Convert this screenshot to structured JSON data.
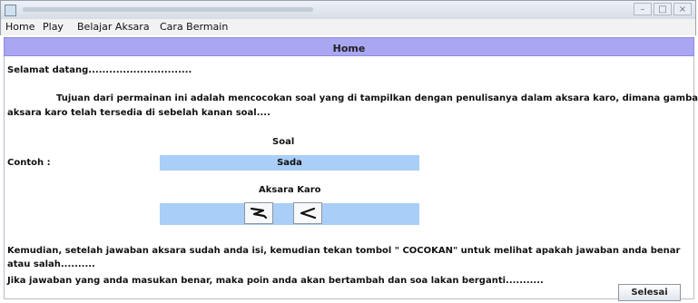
{
  "menu": [
    "Home",
    "Play",
    "Belajar Aksara",
    "Cara Bermain"
  ],
  "header": {
    "title": "Home"
  },
  "content": {
    "greeting": "Selamat datang..............................",
    "intro_line1": "Tujuan dari permainan ini adalah mencocokan soal yang di tampilkan dengan penulisanya dalam aksara karo, dimana gambar",
    "intro_line2": "aksara karo telah tersedia di sebelah kanan soal....",
    "example_label": "Contoh :",
    "soal_label": "Soal",
    "soal_value": "Sada",
    "aksara_label": "Aksara Karo",
    "info_line1": "Kemudian, setelah jawaban  aksara sudah anda isi, kemudian tekan tombol \" COCOKAN\" untuk melihat apakah jawaban anda benar",
    "info_line2": "atau salah..........",
    "info_line3": "Jika  jawaban yang anda masukan benar, maka poin anda akan bertambah dan soa lakan berganti..........."
  },
  "button": {
    "label": "Selesai"
  },
  "colors": {
    "header": "#a9a6f2",
    "field": "#a9cef7"
  },
  "icons": [
    "app-icon",
    "minimize-icon",
    "maximize-icon",
    "close-icon",
    "aksara-glyph-1",
    "aksara-glyph-2"
  ]
}
